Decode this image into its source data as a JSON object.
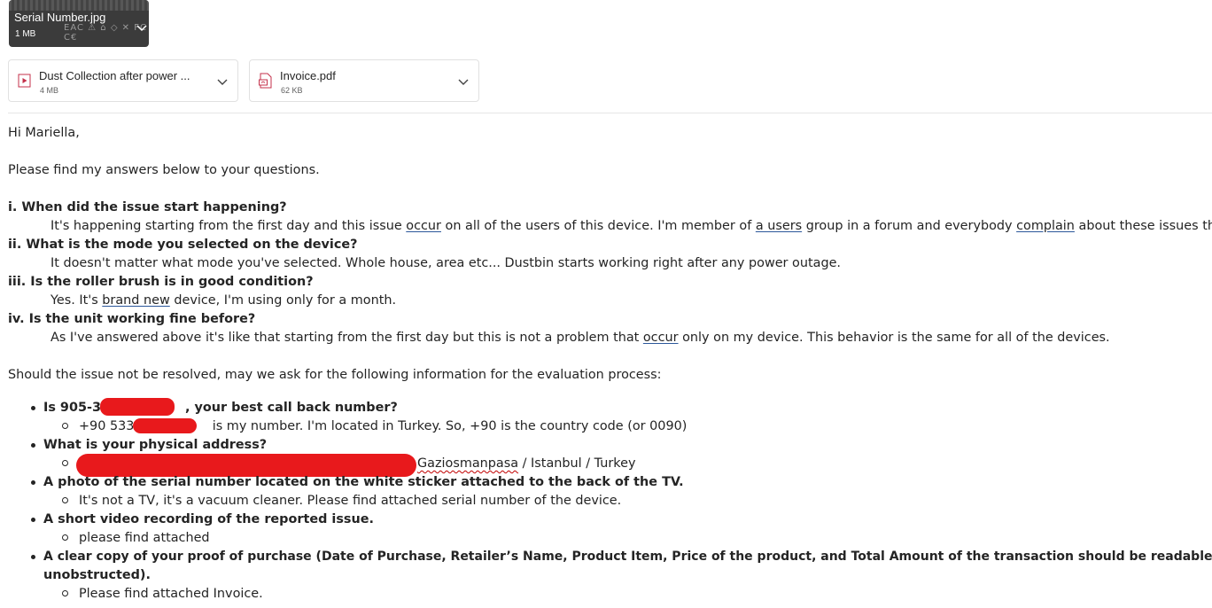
{
  "attachments": {
    "image": {
      "name": "Serial Number.jpg",
      "size": "1 MB",
      "icon": "chevron-down-icon"
    },
    "files": [
      {
        "name": "Dust Collection after power ...",
        "size": "4 MB",
        "icon": "video-file-icon"
      },
      {
        "name": "Invoice.pdf",
        "size": "62 KB",
        "icon": "pdf-file-icon"
      }
    ]
  },
  "email": {
    "greeting": "Hi Mariella,",
    "intro": "Please find my answers below to your questions.",
    "qa": [
      {
        "q": "i. When did the issue start happening?",
        "a_parts": [
          "It's happening starting from the first day and this issue ",
          "occur",
          " on all of the users of this device. I'm member of ",
          "a users",
          " group in a forum and everybody ",
          "complain",
          " about these issues there."
        ]
      },
      {
        "q": "ii. What is the mode you selected on the device?",
        "a_parts": [
          "It doesn't matter what mode you've selected. Whole house, area etc... Dustbin starts working right after any power outage."
        ]
      },
      {
        "q": "iii. Is the roller brush is in good condition?",
        "a_parts": [
          "Yes. It's ",
          "brand new",
          " device, I'm using only for a month."
        ]
      },
      {
        "q": "iv. Is the unit working fine before?",
        "a_parts": [
          "As I've answered above it's like that starting from the first day but this is not a problem that ",
          "occur",
          " only on my device. This behavior is the same for all of the devices."
        ]
      }
    ],
    "should": "Should the issue not be resolved, may we ask for the following information for the evaluation process:",
    "items": [
      {
        "q_start": "Is 905-33",
        "q_end": ", your best call back number?",
        "answer_start": "+90 533 6",
        "answer_end": " is my number. I'm located in Turkey. So, +90 is the country code (or 0090)"
      },
      {
        "q": "What is your physical address?",
        "answer_end_wavy": "Gaziosmanpasa",
        "answer_end_rest": " / Istanbul / Turkey"
      },
      {
        "q": "A photo of the serial number located on the white sticker attached to the back of the TV.",
        "answer": "It's not a TV, it's a vacuum cleaner. Please find attached serial number of the device."
      },
      {
        "q": "A short video recording of the reported issue.",
        "answer": "please find attached"
      },
      {
        "q_line1": "A clear copy of your proof of purchase (Date of Purchase, Retailer’s Name, Product Item, Price of the product, and Total Amount of the transaction should be readable and",
        "q_line2": "unobstructed).",
        "answer": "Please find attached Invoice."
      }
    ],
    "redaction_color": "#e8191c"
  }
}
